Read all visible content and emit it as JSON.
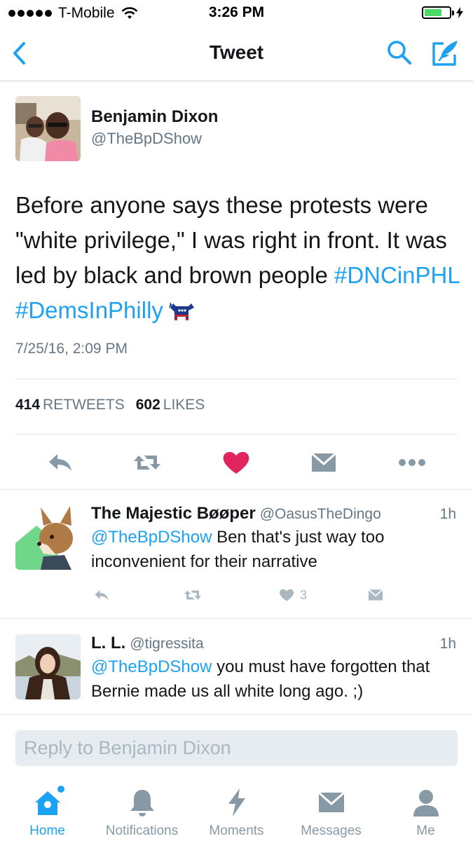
{
  "status_bar": {
    "carrier": "T-Mobile",
    "time": "3:26 PM",
    "battery_color": "#4cd964"
  },
  "nav": {
    "title": "Tweet",
    "icons": [
      "back-chevron-icon",
      "search-icon",
      "compose-icon"
    ],
    "accent": "#1da1f2"
  },
  "tweet": {
    "author_name": "Benjamin Dixon",
    "author_handle": "@TheBpDShow",
    "text_plain": "Before anyone says these protests were \"white privilege,\" I was right in front. It was led by black and brown people",
    "hashtag1": "#DNCinPHL",
    "hashtag2": "#DemsInPhilly",
    "timestamp": "7/25/16, 2:09 PM",
    "retweets_count": "414",
    "retweets_label": "RETWEETS",
    "likes_count": "602",
    "likes_label": "LIKES",
    "like_color": "#e0245e"
  },
  "replies": [
    {
      "name": "The Majestic Bøøper",
      "handle": "@OasusTheDingo",
      "time": "1h",
      "mention": "@TheBpDShow",
      "text": " Ben that's just way too inconvenient for their narrative",
      "likes": "3"
    },
    {
      "name": "L. L.",
      "handle": "@tigressita",
      "time": "1h",
      "mention": "@TheBpDShow",
      "text": " you must have forgotten that Bernie made us all white long ago. ;)"
    }
  ],
  "reply_box": {
    "placeholder": "Reply to Benjamin Dixon"
  },
  "tabs": [
    {
      "label": "Home",
      "icon": "home-icon",
      "active": true
    },
    {
      "label": "Notifications",
      "icon": "bell-icon"
    },
    {
      "label": "Moments",
      "icon": "lightning-icon"
    },
    {
      "label": "Messages",
      "icon": "envelope-icon"
    },
    {
      "label": "Me",
      "icon": "person-icon"
    }
  ]
}
